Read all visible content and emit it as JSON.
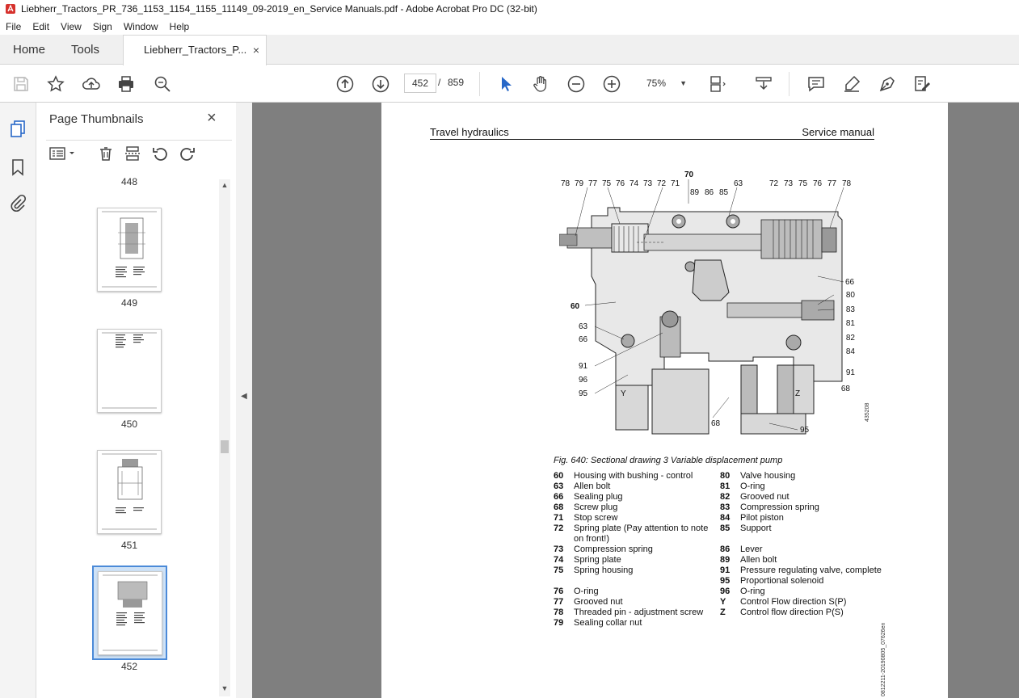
{
  "window": {
    "title": "Liebherr_Tractors_PR_736_1153_1154_1155_11149_09-2019_en_Service Manuals.pdf - Adobe Acrobat Pro DC (32-bit)"
  },
  "menu": [
    "File",
    "Edit",
    "View",
    "Sign",
    "Window",
    "Help"
  ],
  "tabs": {
    "home": "Home",
    "tools": "Tools",
    "document": "Liebherr_Tractors_P...",
    "close": "×"
  },
  "toolbar": {
    "current_page": "452",
    "separator": "/",
    "total_pages": "859",
    "zoom": "75%"
  },
  "panel": {
    "title": "Page Thumbnails",
    "close": "×",
    "thumbnails": [
      {
        "label": "448"
      },
      {
        "label": "449"
      },
      {
        "label": "450"
      },
      {
        "label": "451"
      },
      {
        "label": "452",
        "selected": true
      }
    ]
  },
  "page": {
    "header_left": "Travel hydraulics",
    "header_right": "Service manual",
    "figure_caption": "Fig. 640: Sectional drawing 3 Variable displacement pump",
    "side_code": "435208",
    "footer_code": "0812211-20190805_07626en",
    "callouts_top_left": [
      "78",
      "79",
      "77",
      "75",
      "76",
      "74",
      "73",
      "72",
      "71"
    ],
    "callouts_top_mid": [
      "70",
      "89",
      "86",
      "85",
      "63"
    ],
    "callouts_top_right": [
      "72",
      "73",
      "75",
      "76",
      "77",
      "78"
    ],
    "callouts_right": [
      "66",
      "80",
      "83",
      "81",
      "82",
      "84",
      "91",
      "68"
    ],
    "callouts_left": [
      "60",
      "63",
      "66",
      "91",
      "96",
      "95"
    ],
    "callouts_bottom": [
      "68",
      "95"
    ],
    "port_y": "Y",
    "port_z": "Z",
    "legend_left": [
      {
        "num": "60",
        "text": "Housing with bushing - control"
      },
      {
        "num": "63",
        "text": "Allen bolt"
      },
      {
        "num": "66",
        "text": "Sealing plug"
      },
      {
        "num": "68",
        "text": "Screw plug"
      },
      {
        "num": "71",
        "text": "Stop screw"
      },
      {
        "num": "72",
        "text": "Spring plate (Pay attention to note on front!)"
      },
      {
        "num": "73",
        "text": "Compression spring"
      },
      {
        "num": "74",
        "text": "Spring plate"
      },
      {
        "num": "75",
        "text": "Spring housing"
      },
      {
        "num": "76",
        "text": "O-ring"
      },
      {
        "num": "77",
        "text": "Grooved nut"
      },
      {
        "num": "78",
        "text": "Threaded pin - adjustment screw"
      },
      {
        "num": "79",
        "text": "Sealing collar nut"
      }
    ],
    "legend_right": [
      {
        "num": "80",
        "text": "Valve housing"
      },
      {
        "num": "81",
        "text": "O-ring"
      },
      {
        "num": "82",
        "text": "Grooved nut"
      },
      {
        "num": "83",
        "text": "Compression spring"
      },
      {
        "num": "84",
        "text": "Pilot piston"
      },
      {
        "num": "85",
        "text": "Support"
      },
      {
        "num": "86",
        "text": "Lever"
      },
      {
        "num": "89",
        "text": "Allen bolt"
      },
      {
        "num": "91",
        "text": "Pressure regulating valve, complete"
      },
      {
        "num": "95",
        "text": "Proportional solenoid"
      },
      {
        "num": "96",
        "text": "O-ring"
      },
      {
        "num": "Y",
        "text": "Control Flow direction S(P)"
      },
      {
        "num": "Z",
        "text": "Control flow direction P(S)"
      }
    ]
  },
  "colors": {
    "accent_red": "#d6322d",
    "selection_blue": "#4b8ad8",
    "doc_background": "#7f7f7f"
  }
}
